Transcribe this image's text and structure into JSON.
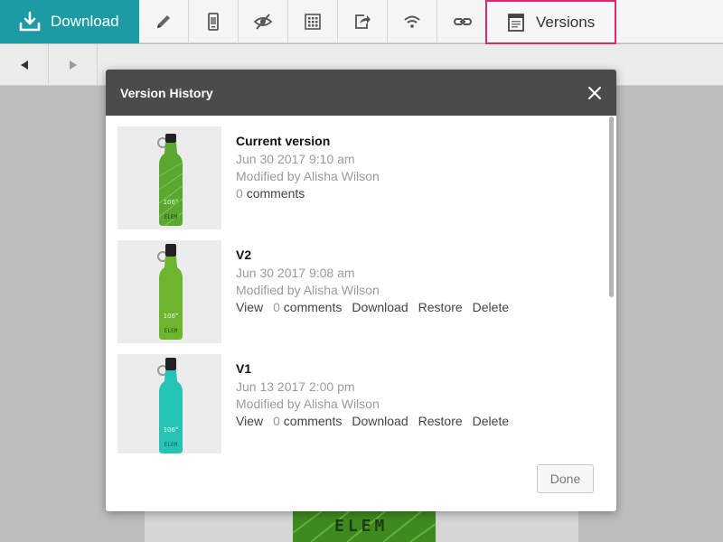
{
  "toolbar": {
    "download_label": "Download",
    "versions_label": "Versions",
    "tools": [
      "pencil-icon",
      "phone-icon",
      "eye-off-icon",
      "grid-icon",
      "export-icon",
      "wifi-icon",
      "link-icon"
    ],
    "accent": "#1d9ba5",
    "highlight": "#e0296d"
  },
  "subbar": {
    "prev_icon": "triangle-left-icon",
    "next_icon": "triangle-right-icon"
  },
  "canvas_art": {
    "logo_text": "ELEM"
  },
  "dialog": {
    "title": "Version History",
    "done_label": "Done",
    "versions": [
      {
        "name": "Current version",
        "date": "Jun 30 2017 9:10 am",
        "modified": "Modified by Alisha Wilson",
        "comment_count": "0",
        "comments_label": "comments",
        "bottle_color": "#5aa832",
        "bottle_label": "106°",
        "bottle_logo": "ELEM"
      },
      {
        "name": "V2",
        "date": "Jun 30 2017 9:08 am",
        "modified": "Modified by Alisha Wilson",
        "view_label": "View",
        "comment_count": "0",
        "comments_label": "comments",
        "download_label": "Download",
        "restore_label": "Restore",
        "delete_label": "Delete",
        "bottle_color": "#6cb52c",
        "bottle_label": "106°",
        "bottle_logo": "ELEM"
      },
      {
        "name": "V1",
        "date": "Jun 13 2017 2:00 pm",
        "modified": "Modified by Alisha Wilson",
        "view_label": "View",
        "comment_count": "0",
        "comments_label": "comments",
        "download_label": "Download",
        "restore_label": "Restore",
        "delete_label": "Delete",
        "bottle_color": "#26c4b4",
        "bottle_label": "106°",
        "bottle_logo": "ELEM"
      }
    ]
  }
}
